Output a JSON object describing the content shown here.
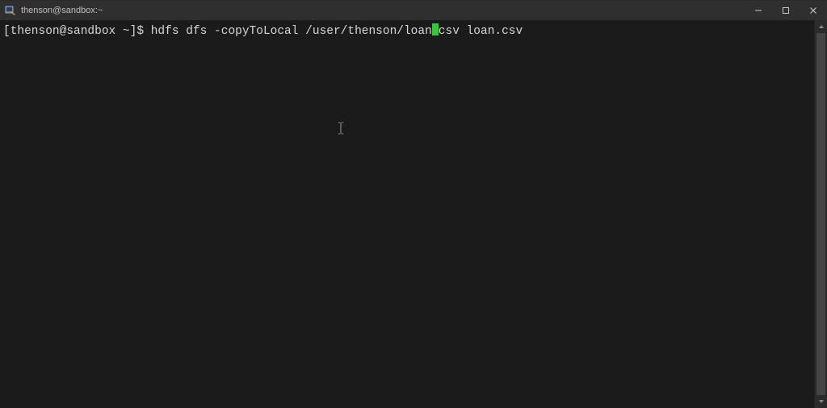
{
  "window": {
    "title": "thenson@sandbox:~"
  },
  "terminal": {
    "prompt": "[thenson@sandbox ~]$ ",
    "command_before_cursor": "hdfs dfs -copyToLocal /user/thenson/loan",
    "cursor_char": ".",
    "command_after_cursor": "csv loan.csv"
  },
  "colors": {
    "cursor": "#2bcf2b",
    "background": "#1b1b1b",
    "titlebar": "#2f2f2f",
    "text": "#d6d6d6"
  }
}
